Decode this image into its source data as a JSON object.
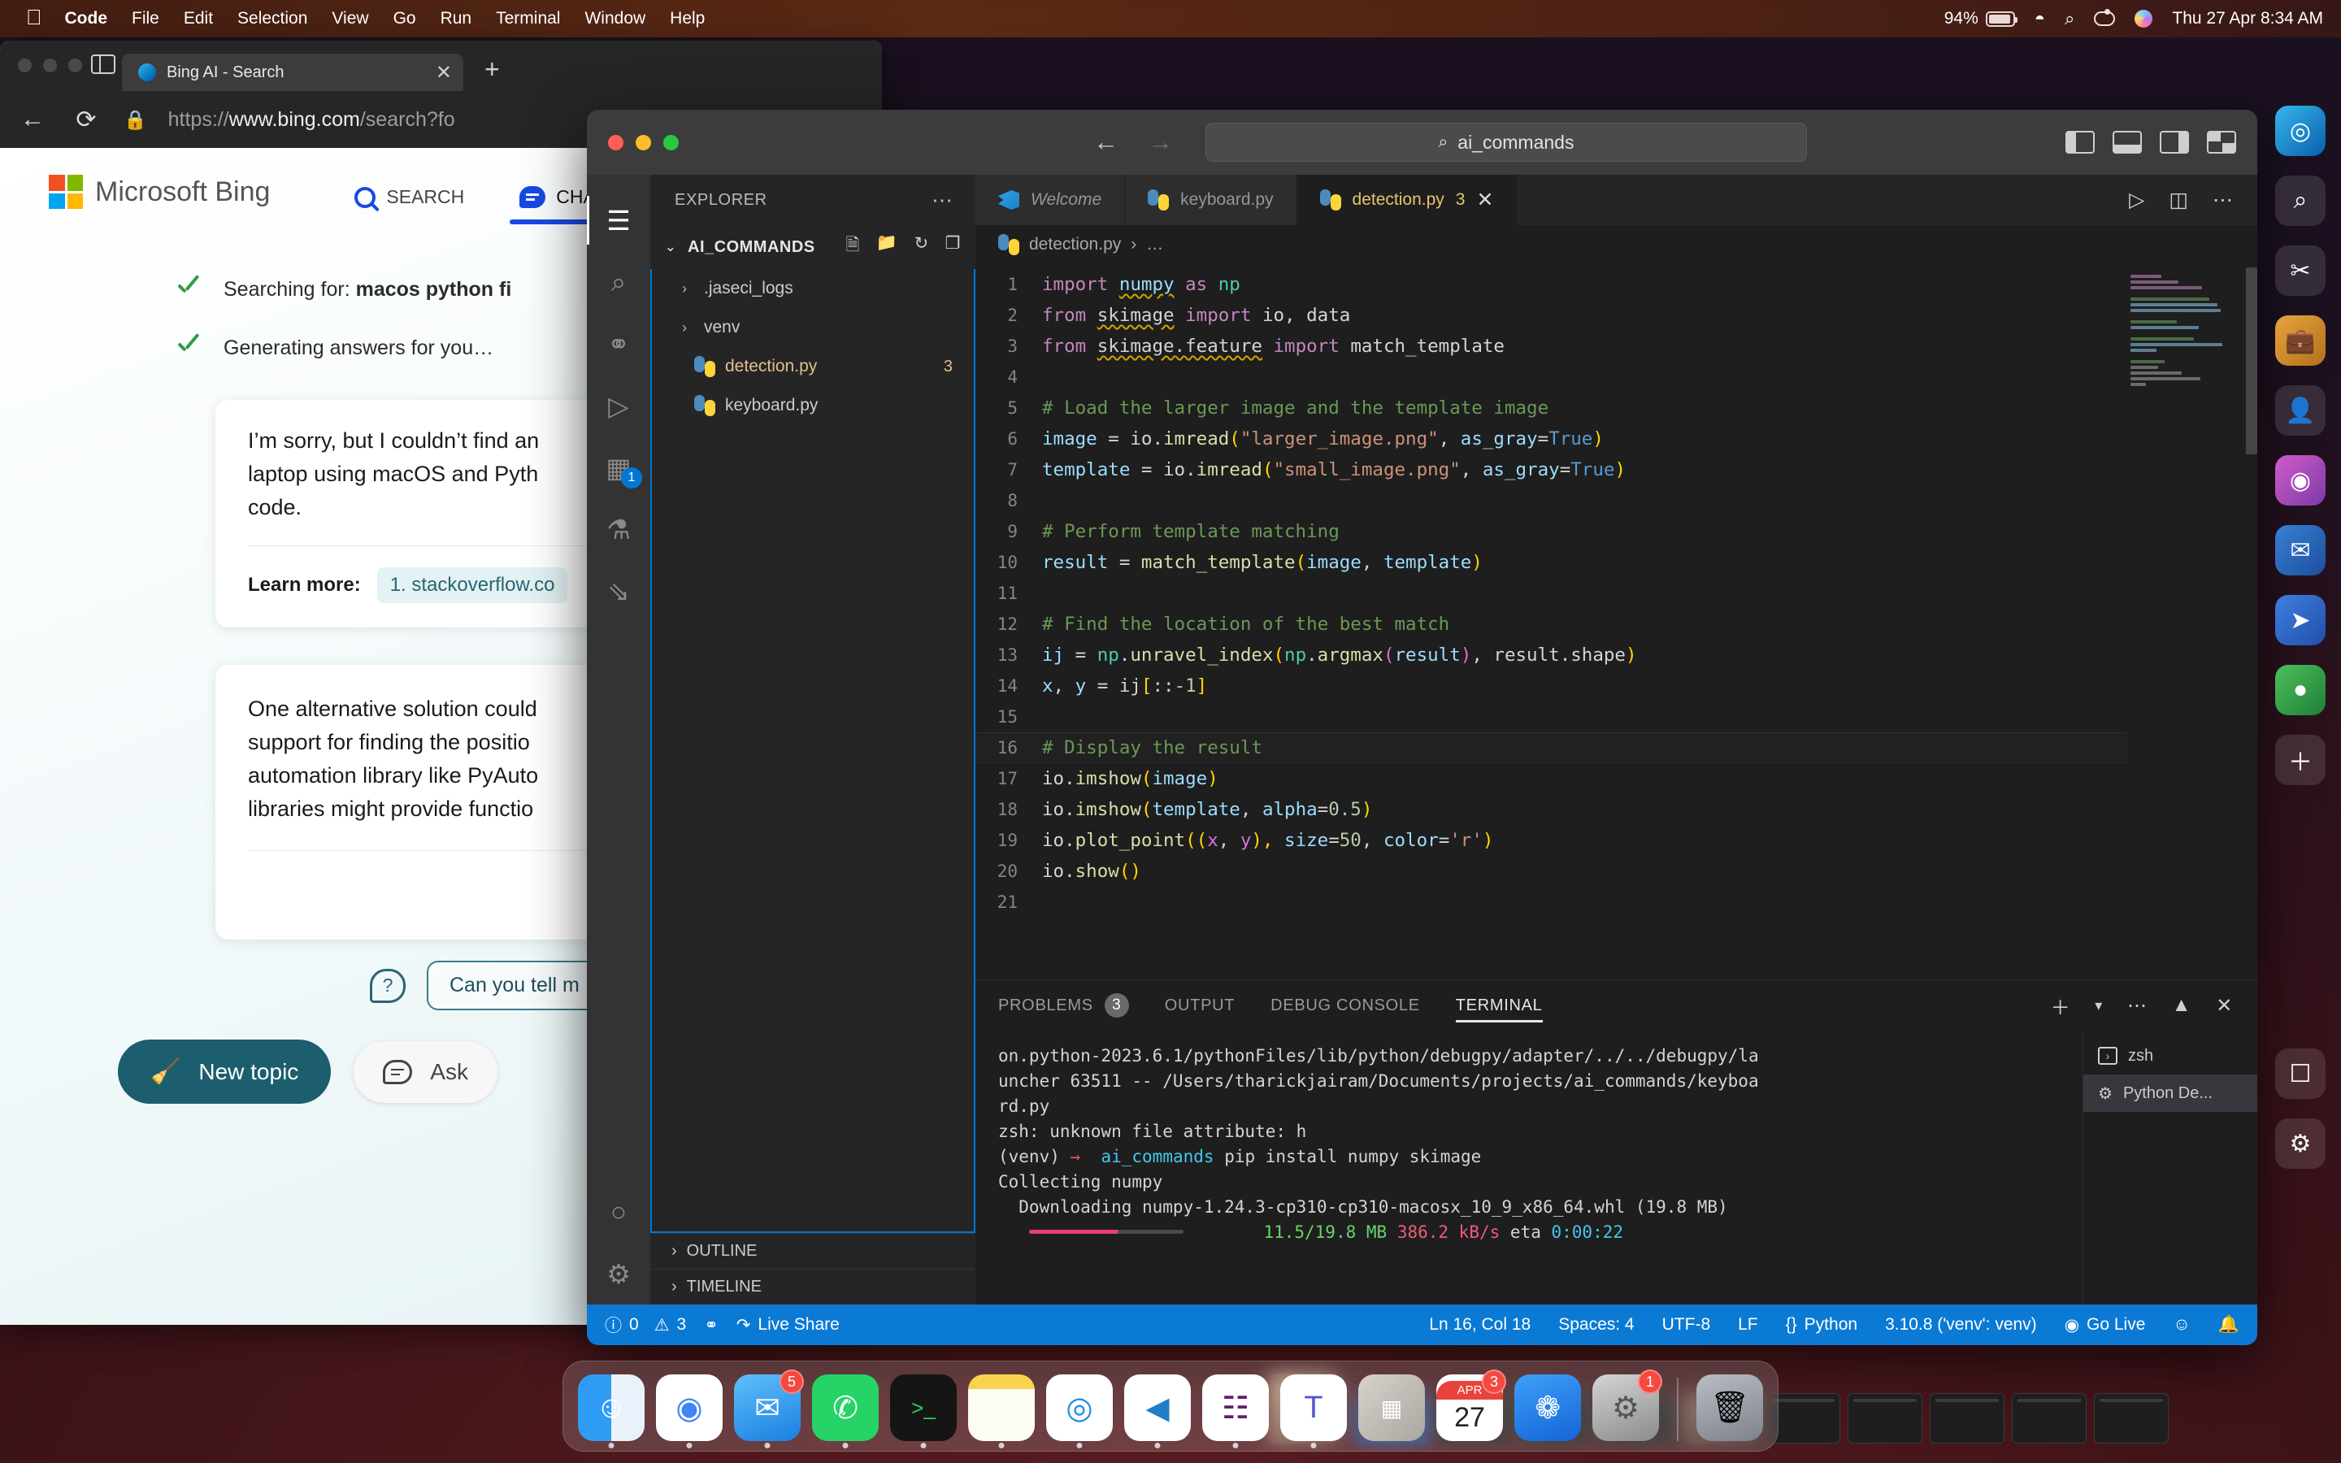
{
  "menubar": {
    "apple": "",
    "items": [
      "Code",
      "File",
      "Edit",
      "Selection",
      "View",
      "Go",
      "Run",
      "Terminal",
      "Window",
      "Help"
    ],
    "battery_percent": "94%",
    "datetime": "Thu 27 Apr  8:34 AM"
  },
  "browser": {
    "tab_title": "Bing AI - Search",
    "tab_close": "✕",
    "new_tab": "+",
    "back": "←",
    "reload": "⟳",
    "lock": "🔒",
    "url_prefix": "https://",
    "url_host": "www.bing.com",
    "url_path": "/search?fo"
  },
  "bing": {
    "logo_text": "Microsoft Bing",
    "nav": [
      {
        "label": "SEARCH",
        "icon": "search-icon",
        "active": false
      },
      {
        "label": "CHAT",
        "icon": "chat-bubble-icon",
        "active": true
      }
    ],
    "steps": [
      {
        "prefix": "Searching for: ",
        "query": "macos python fi"
      },
      {
        "prefix": "Generating answers for you…",
        "query": ""
      }
    ],
    "answer1": "I’m sorry, but I couldn’t find an\nlaptop using macOS and Pyth\ncode.",
    "learn_more_label": "Learn more:",
    "citation": "1. stackoverflow.co",
    "answer2": "One alternative solution could\nsupport for finding the positio\nautomation library like PyAuto\nlibraries might provide functio",
    "suggestion": "Can you tell m",
    "new_topic": "New topic",
    "ask_placeholder": "Ask"
  },
  "vscode": {
    "search_value": "ai_commands",
    "nav_back": "←",
    "nav_forward": "→",
    "activitybar": [
      {
        "name": "explorer-icon",
        "glyph": "❐",
        "active": true,
        "badge": ""
      },
      {
        "name": "search-icon",
        "glyph": "⌕",
        "active": false,
        "badge": ""
      },
      {
        "name": "source-control-icon",
        "glyph": "⎇",
        "active": false,
        "badge": ""
      },
      {
        "name": "run-debug-icon",
        "glyph": "▷",
        "active": false,
        "badge": ""
      },
      {
        "name": "extensions-icon",
        "glyph": "⊞",
        "active": false,
        "badge": "1"
      },
      {
        "name": "testing-icon",
        "glyph": "⚗",
        "active": false,
        "badge": ""
      },
      {
        "name": "remote-explorer-icon",
        "glyph": "⥂",
        "active": false,
        "badge": ""
      },
      {
        "name": "accounts-icon",
        "glyph": "◯",
        "active": false,
        "badge": ""
      },
      {
        "name": "settings-gear-icon",
        "glyph": "⚙",
        "active": false,
        "badge": ""
      }
    ],
    "sidebar": {
      "title": "EXPLORER",
      "more": "⋯",
      "folder_name": "AI_COMMANDS",
      "folder_chevron": "⌄",
      "actions": [
        "new-file-icon",
        "new-folder-icon",
        "refresh-icon",
        "collapse-all-icon"
      ],
      "tree": [
        {
          "label": ".jaseci_logs",
          "type": "folder",
          "chevron": "›",
          "count": ""
        },
        {
          "label": "venv",
          "type": "folder",
          "chevron": "›",
          "count": ""
        },
        {
          "label": "detection.py",
          "type": "python",
          "chevron": "",
          "count": "3",
          "warn": true
        },
        {
          "label": "keyboard.py",
          "type": "python",
          "chevron": "",
          "count": "",
          "warn": false
        }
      ],
      "footer": [
        {
          "label": "OUTLINE",
          "chevron": "›"
        },
        {
          "label": "TIMELINE",
          "chevron": "›"
        }
      ]
    },
    "tabs": [
      {
        "label": "Welcome",
        "icon": "vscode-logo-icon",
        "active": false,
        "count": "",
        "close": ""
      },
      {
        "label": "keyboard.py",
        "icon": "python-icon",
        "active": false,
        "count": "",
        "close": ""
      },
      {
        "label": "detection.py",
        "icon": "python-icon",
        "active": true,
        "count": "3",
        "close": "✕"
      }
    ],
    "tab_actions": [
      "run-icon",
      "split-editor-icon",
      "more-actions-icon"
    ],
    "breadcrumb": {
      "file": "detection.py",
      "sep": "›",
      "rest": "…"
    },
    "code_lines": [
      {
        "n": "1",
        "tokens": [
          [
            "kw",
            "import"
          ],
          [
            "op",
            " "
          ],
          [
            "var squig",
            "numpy"
          ],
          [
            "op",
            " "
          ],
          [
            "kw",
            "as"
          ],
          [
            "op",
            " "
          ],
          [
            "cls",
            "np"
          ]
        ]
      },
      {
        "n": "2",
        "tokens": [
          [
            "kw",
            "from"
          ],
          [
            "op",
            " "
          ],
          [
            "ctxt squig",
            "skimage"
          ],
          [
            "op",
            " "
          ],
          [
            "kw",
            "import"
          ],
          [
            "op",
            " "
          ],
          [
            "ctxt",
            "io"
          ],
          [
            "op",
            ", "
          ],
          [
            "ctxt",
            "data"
          ]
        ]
      },
      {
        "n": "3",
        "tokens": [
          [
            "kw",
            "from"
          ],
          [
            "op",
            " "
          ],
          [
            "ctxt squig",
            "skimage.feature"
          ],
          [
            "op",
            " "
          ],
          [
            "kw",
            "import"
          ],
          [
            "op",
            " "
          ],
          [
            "ctxt",
            "match_template"
          ]
        ]
      },
      {
        "n": "4",
        "tokens": []
      },
      {
        "n": "5",
        "tokens": [
          [
            "cmt",
            "# Load the larger image and the template image"
          ]
        ]
      },
      {
        "n": "6",
        "tokens": [
          [
            "var",
            "image"
          ],
          [
            "op",
            " = "
          ],
          [
            "ctxt",
            "io"
          ],
          [
            "op",
            "."
          ],
          [
            "fn",
            "imread"
          ],
          [
            "p1",
            "("
          ],
          [
            "str",
            "\"larger_image.png\""
          ],
          [
            "op",
            ", "
          ],
          [
            "var",
            "as_gray"
          ],
          [
            "op",
            "="
          ],
          [
            "bool",
            "True"
          ],
          [
            "p1",
            ")"
          ]
        ]
      },
      {
        "n": "7",
        "tokens": [
          [
            "var",
            "template"
          ],
          [
            "op",
            " = "
          ],
          [
            "ctxt",
            "io"
          ],
          [
            "op",
            "."
          ],
          [
            "fn",
            "imread"
          ],
          [
            "p1",
            "("
          ],
          [
            "str",
            "\"small_image.png\""
          ],
          [
            "op",
            ", "
          ],
          [
            "var",
            "as_gray"
          ],
          [
            "op",
            "="
          ],
          [
            "bool",
            "True"
          ],
          [
            "p1",
            ")"
          ]
        ]
      },
      {
        "n": "8",
        "tokens": []
      },
      {
        "n": "9",
        "tokens": [
          [
            "cmt",
            "# Perform template matching"
          ]
        ]
      },
      {
        "n": "10",
        "tokens": [
          [
            "var",
            "result"
          ],
          [
            "op",
            " = "
          ],
          [
            "fn",
            "match_template"
          ],
          [
            "p1",
            "("
          ],
          [
            "var",
            "image"
          ],
          [
            "op",
            ", "
          ],
          [
            "var",
            "template"
          ],
          [
            "p1",
            ")"
          ]
        ]
      },
      {
        "n": "11",
        "tokens": []
      },
      {
        "n": "12",
        "tokens": [
          [
            "cmt",
            "# Find the location of the best match"
          ]
        ]
      },
      {
        "n": "13",
        "tokens": [
          [
            "var",
            "ij"
          ],
          [
            "op",
            " = "
          ],
          [
            "cls",
            "np"
          ],
          [
            "op",
            "."
          ],
          [
            "fn",
            "unravel_index"
          ],
          [
            "p1",
            "("
          ],
          [
            "cls",
            "np"
          ],
          [
            "op",
            "."
          ],
          [
            "fn",
            "argmax"
          ],
          [
            "p2",
            "("
          ],
          [
            "var",
            "result"
          ],
          [
            "p2",
            ")"
          ],
          [
            "op",
            ", "
          ],
          [
            "ctxt",
            "result.shape"
          ],
          [
            "p1",
            ")"
          ]
        ]
      },
      {
        "n": "14",
        "tokens": [
          [
            "var",
            "x"
          ],
          [
            "op",
            ", "
          ],
          [
            "var",
            "y"
          ],
          [
            "op",
            " = "
          ],
          [
            "ctxt",
            "ij"
          ],
          [
            "p1",
            "["
          ],
          [
            "op",
            "::"
          ],
          [
            "num",
            "-1"
          ],
          [
            "p1",
            "]"
          ]
        ]
      },
      {
        "n": "15",
        "tokens": []
      },
      {
        "n": "16",
        "tokens": [
          [
            "cmt",
            "# Display the result"
          ]
        ],
        "highlight": true
      },
      {
        "n": "17",
        "tokens": [
          [
            "ctxt",
            "io"
          ],
          [
            "op",
            "."
          ],
          [
            "fn",
            "imshow"
          ],
          [
            "p1",
            "("
          ],
          [
            "var",
            "image"
          ],
          [
            "p1",
            ")"
          ]
        ]
      },
      {
        "n": "18",
        "tokens": [
          [
            "ctxt",
            "io"
          ],
          [
            "op",
            "."
          ],
          [
            "fn",
            "imshow"
          ],
          [
            "p1",
            "("
          ],
          [
            "var",
            "template"
          ],
          [
            "op",
            ", "
          ],
          [
            "var",
            "alpha"
          ],
          [
            "op",
            "="
          ],
          [
            "num",
            "0.5"
          ],
          [
            "p1",
            ")"
          ]
        ]
      },
      {
        "n": "19",
        "tokens": [
          [
            "ctxt",
            "io"
          ],
          [
            "op",
            "."
          ],
          [
            "fn",
            "plot_point"
          ],
          [
            "p1",
            "(("
          ],
          [
            "p2",
            "x"
          ],
          [
            "op",
            ", "
          ],
          [
            "p2",
            "y"
          ],
          [
            "p1",
            "), "
          ],
          [
            "var",
            "size"
          ],
          [
            "op",
            "="
          ],
          [
            "num",
            "50"
          ],
          [
            "op",
            ", "
          ],
          [
            "var",
            "color"
          ],
          [
            "op",
            "="
          ],
          [
            "str",
            "'r'"
          ],
          [
            "p1",
            ")"
          ]
        ]
      },
      {
        "n": "20",
        "tokens": [
          [
            "ctxt",
            "io"
          ],
          [
            "op",
            "."
          ],
          [
            "fn",
            "show"
          ],
          [
            "p1",
            "()"
          ]
        ]
      },
      {
        "n": "21",
        "tokens": []
      }
    ],
    "panel": {
      "tabs": [
        {
          "label": "PROBLEMS",
          "badge": "3",
          "active": false
        },
        {
          "label": "OUTPUT",
          "badge": "",
          "active": false
        },
        {
          "label": "DEBUG CONSOLE",
          "badge": "",
          "active": false
        },
        {
          "label": "TERMINAL",
          "badge": "",
          "active": true
        }
      ],
      "actions": [
        "add-terminal-icon",
        "split-chevron-icon",
        "more-icon",
        "maximize-icon",
        "close-icon"
      ],
      "terminal_lines": [
        "on.python-2023.6.1/pythonFiles/lib/python/debugpy/adapter/../../debugpy/la",
        "uncher 63511 -- /Users/tharickjairam/Documents/projects/ai_commands/keyboa",
        "rd.py",
        "zsh: unknown file attribute: h"
      ],
      "prompt_venv": "(venv)",
      "prompt_arrow": "→",
      "prompt_dir": "ai_commands",
      "prompt_cmd": "pip install numpy skimage",
      "collecting": "Collecting numpy",
      "downloading": "  Downloading numpy-1.24.3-cp310-cp310-macosx_10_9_x86_64.whl (19.8 MB)",
      "progress_size": "11.5/19.8 MB",
      "progress_speed": "386.2 kB/s",
      "progress_eta": "eta 0:00:22",
      "terminal_list": [
        {
          "label": "zsh",
          "icon": "terminal-icon",
          "selected": false
        },
        {
          "label": "Python De...",
          "icon": "debug-bug-icon",
          "selected": true
        }
      ]
    },
    "statusbar": {
      "errors": "0",
      "warnings": "3",
      "ports_icon": "ports-icon",
      "live_share": "Live Share",
      "cursor": "Ln 16, Col 18",
      "spaces": "Spaces: 4",
      "encoding": "UTF-8",
      "eol": "LF",
      "language": "Python",
      "interpreter": "3.10.8 ('venv': venv)",
      "go_live": "Go Live",
      "feedback_icon": "feedback-icon",
      "bell_icon": "bell-icon"
    }
  },
  "dock": {
    "items": [
      {
        "name": "finder",
        "badge": "",
        "running": true
      },
      {
        "name": "chrome",
        "badge": "",
        "running": true
      },
      {
        "name": "mail",
        "badge": "5",
        "running": true
      },
      {
        "name": "whatsapp",
        "badge": "",
        "running": true
      },
      {
        "name": "terminal",
        "badge": "",
        "running": true
      },
      {
        "name": "notes",
        "badge": "",
        "running": true
      },
      {
        "name": "edge",
        "badge": "",
        "running": true
      },
      {
        "name": "vscode",
        "badge": "",
        "running": true
      },
      {
        "name": "slack",
        "badge": "",
        "running": true
      },
      {
        "name": "teams",
        "badge": "",
        "running": true
      },
      {
        "name": "launchpad",
        "badge": "",
        "running": false
      },
      {
        "name": "calendar",
        "badge": "3",
        "running": false,
        "month": "APR",
        "day": "27"
      },
      {
        "name": "app-store",
        "badge": "",
        "running": false
      },
      {
        "name": "system-settings",
        "badge": "1",
        "running": false
      },
      {
        "name": "trash",
        "badge": "",
        "running": false
      }
    ]
  }
}
